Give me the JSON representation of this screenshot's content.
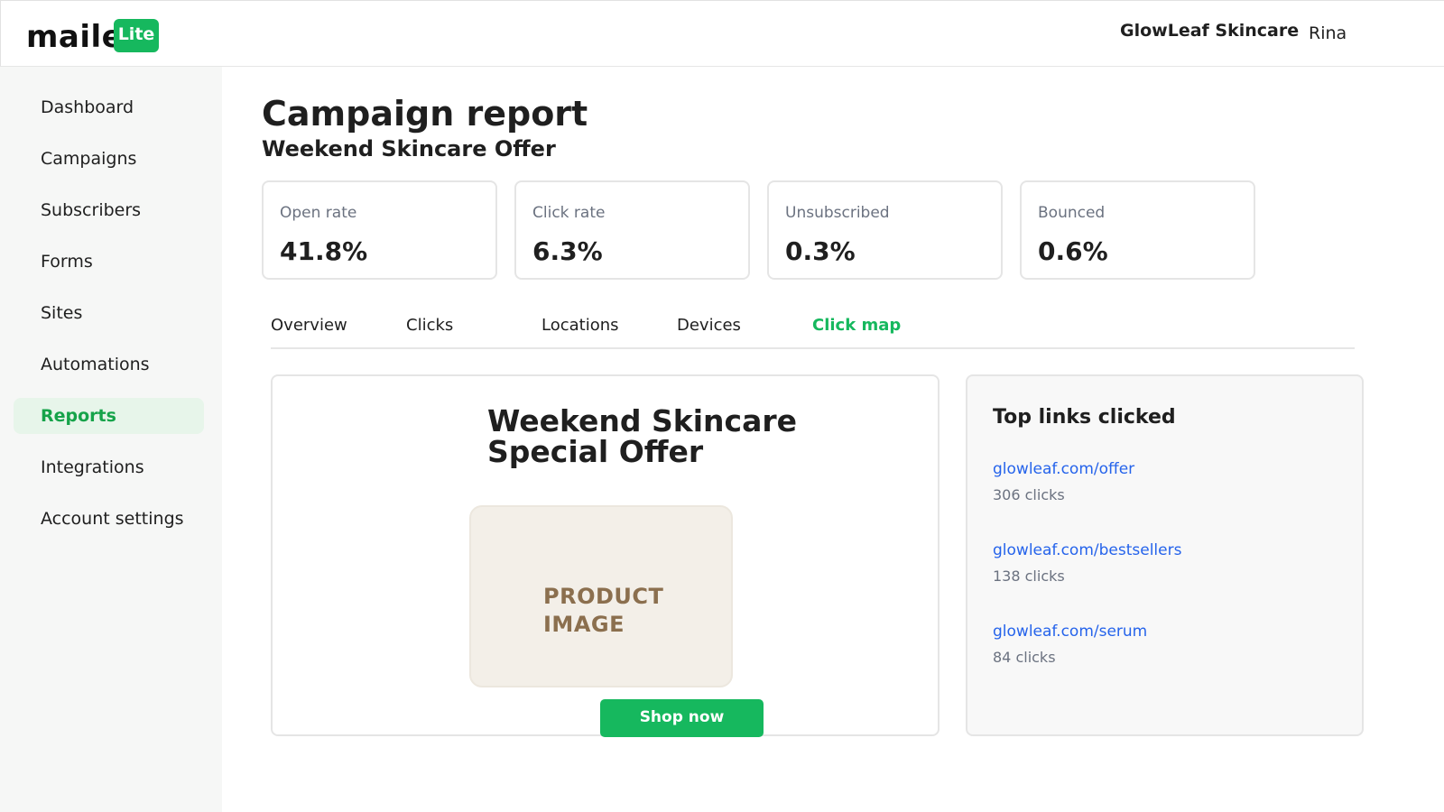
{
  "brand": {
    "logo_text": "maile",
    "badge": "Lite",
    "accent_color": "#16b85e"
  },
  "header": {
    "account_name": "GlowLeaf Skincare",
    "user_name": "Rina"
  },
  "sidebar": {
    "items": [
      {
        "label": "Dashboard",
        "active": false
      },
      {
        "label": "Campaigns",
        "active": false
      },
      {
        "label": "Subscribers",
        "active": false
      },
      {
        "label": "Forms",
        "active": false
      },
      {
        "label": "Sites",
        "active": false
      },
      {
        "label": "Automations",
        "active": false
      },
      {
        "label": "Reports",
        "active": true
      },
      {
        "label": "Integrations",
        "active": false
      },
      {
        "label": "Account settings",
        "active": false
      }
    ]
  },
  "page": {
    "title": "Campaign report",
    "subtitle": "Weekend Skincare Offer"
  },
  "stats": [
    {
      "label": "Open rate",
      "value": "41.8%"
    },
    {
      "label": "Click rate",
      "value": "6.3%"
    },
    {
      "label": "Unsubscribed",
      "value": "0.3%"
    },
    {
      "label": "Bounced",
      "value": "0.6%"
    }
  ],
  "tabs": [
    {
      "label": "Overview",
      "active": false
    },
    {
      "label": "Clicks",
      "active": false
    },
    {
      "label": "Locations",
      "active": false
    },
    {
      "label": "Devices",
      "active": false
    },
    {
      "label": "Click map",
      "active": true
    }
  ],
  "email_preview": {
    "headline": "Weekend Skincare Special Offer",
    "image_placeholder": "PRODUCT IMAGE",
    "button_label": "Shop now"
  },
  "top_links": {
    "title": "Top links clicked",
    "links": [
      {
        "url": "glowleaf.com/offer",
        "clicks": "306 clicks"
      },
      {
        "url": "glowleaf.com/bestsellers",
        "clicks": "138 clicks"
      },
      {
        "url": "glowleaf.com/serum",
        "clicks": "84 clicks"
      }
    ]
  }
}
